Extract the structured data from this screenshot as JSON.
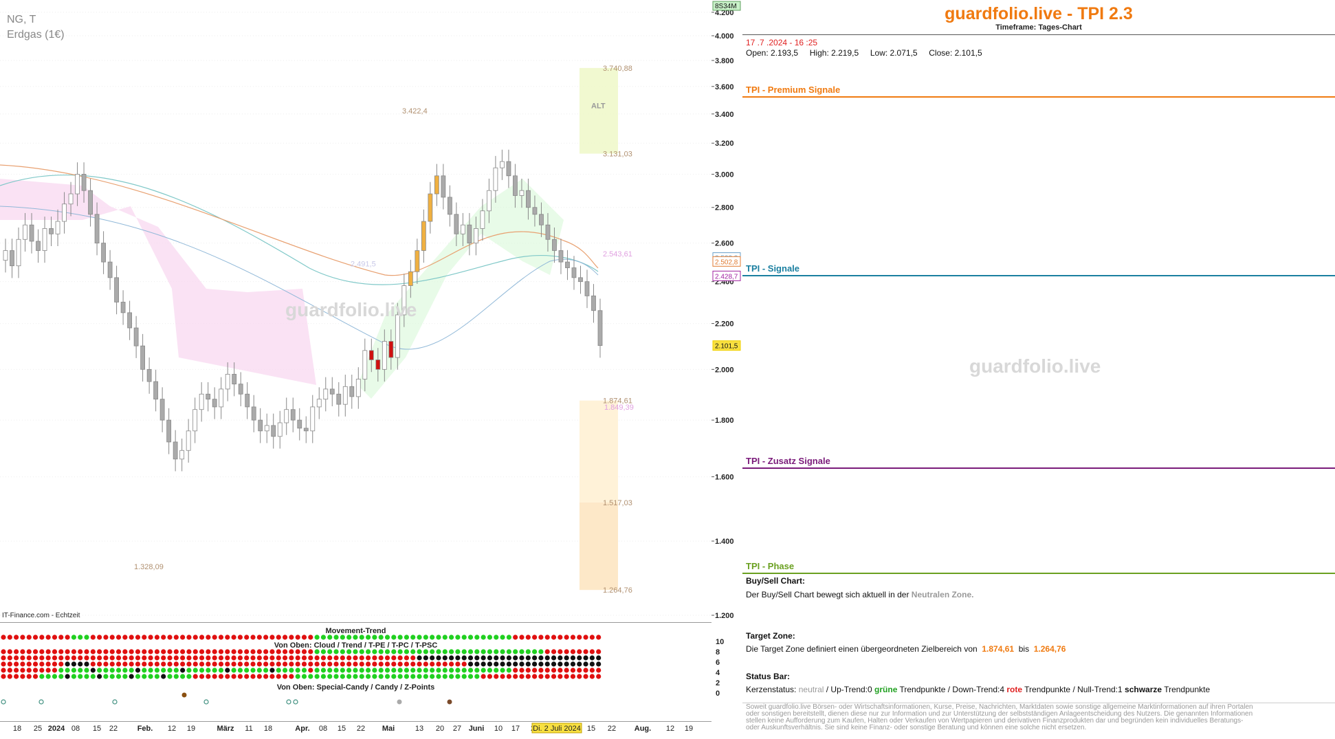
{
  "chart": {
    "symbol": "NG, T",
    "name": "Erdgas (1€)",
    "source": "IT-Finance.com - Echtzeit",
    "watermark": "guardfolio.live",
    "top_badge": "8S34M",
    "bottom_date_badge": "Di. 2 Juli 2024",
    "price_labels": [
      {
        "text": "3.740,88",
        "value": 3740.88
      },
      {
        "text": "3.131,03",
        "value": 3131.03
      },
      {
        "text": "3.422,4",
        "value": 3422.4
      },
      {
        "text": "2.543,61",
        "value": 2543.61
      },
      {
        "text": "2.491,5",
        "value": 2491.5
      },
      {
        "text": "1.874,61",
        "value": 1874.61
      },
      {
        "text": "1.849,39",
        "value": 1849.39
      },
      {
        "text": "1.517,03",
        "value": 1517.03
      },
      {
        "text": "1.328,09",
        "value": 1328.09
      },
      {
        "text": "1.264,76",
        "value": 1264.76
      }
    ],
    "zone_label": "ALT",
    "indicator_titles": {
      "movement": "Movement-Trend",
      "cloud": "Von Oben: Cloud / Trend / T-PE / T-PC / T-PSC",
      "special": "Von Oben: Special-Candy / Candy / Z-Points"
    }
  },
  "chart_data": {
    "type": "candlestick",
    "title": "NG, T",
    "subtitle": "Erdgas (1€)",
    "y_ticks": [
      "4.200",
      "4.000",
      "3.800",
      "3.600",
      "3.400",
      "3.200",
      "3.000",
      "2.800",
      "2.600",
      "2.400",
      "2.200",
      "2.000",
      "1.800",
      "1.600",
      "1.400",
      "1.200"
    ],
    "y_tick_values": [
      4200,
      4000,
      3800,
      3600,
      3400,
      3200,
      3000,
      2800,
      2600,
      2400,
      2200,
      2000,
      1800,
      1600,
      1400,
      1200
    ],
    "y_scale": "log",
    "ylim": [
      1160,
      4250
    ],
    "x_ticks": [
      "18",
      "25",
      "2024",
      "08",
      "15",
      "22",
      "Feb.",
      "12",
      "19",
      "März",
      "11",
      "18",
      "Apr.",
      "08",
      "15",
      "22",
      "Mai",
      "13",
      "20",
      "27",
      "Juni",
      "10",
      "17",
      "2",
      "Di. 2 Juli 2024",
      "15",
      "22",
      "Aug.",
      "12",
      "19"
    ],
    "axis_price_tags": [
      {
        "text": "2.523,3",
        "value": 2523.3,
        "color": "#6aa0c8"
      },
      {
        "text": "2.502,8",
        "value": 2502.8,
        "color": "#e07a30"
      },
      {
        "text": "2.428,7",
        "value": 2428.7,
        "color": "#a020a0"
      },
      {
        "text": "2.101,5",
        "value": 2101.5,
        "color": "#f0d000"
      }
    ],
    "last_close": 2101.5,
    "closes": [
      2560,
      2480,
      2620,
      2700,
      2610,
      2560,
      2680,
      2650,
      2720,
      2820,
      2880,
      3000,
      2900,
      2760,
      2600,
      2500,
      2420,
      2300,
      2250,
      2180,
      2100,
      2000,
      1950,
      1880,
      1800,
      1720,
      1660,
      1690,
      1760,
      1840,
      1900,
      1880,
      1850,
      1920,
      1980,
      1940,
      1900,
      1850,
      1800,
      1760,
      1780,
      1740,
      1790,
      1840,
      1800,
      1770,
      1760,
      1850,
      1880,
      1920,
      1900,
      1860,
      1930,
      1890,
      1960,
      2080,
      2040,
      2000,
      2120,
      2050,
      2240,
      2380,
      2450,
      2560,
      2720,
      2880,
      2990,
      2860,
      2760,
      2650,
      2700,
      2600,
      2680,
      2780,
      2900,
      3040,
      3080,
      2990,
      2870,
      2900,
      2800,
      2760,
      2700,
      2620,
      2560,
      2500,
      2470,
      2420,
      2400,
      2330,
      2260,
      2101.5
    ],
    "candle_window": "2023-12-18 to 2024-07-17",
    "quote": {
      "datetime": "17 .7 .2024 - 16 :25",
      "open": "2.193,5",
      "high": "2.219,5",
      "low": "2.071,5",
      "close": "2.101,5"
    }
  },
  "sidebar": {
    "title": "guardfolio.live - TPI 2.3",
    "timeframe": "Timeframe: Tages-Chart",
    "datetime": "17 .7 .2024 - 16 :25",
    "ohlc": {
      "open_label": "Open:",
      "open": "2.193,5",
      "high_label": "High:",
      "high": "2.219,5",
      "low_label": "Low:",
      "low": "2.071,5",
      "close_label": "Close:",
      "close": "2.101,5"
    },
    "sections": {
      "premium": "TPI - Premium Signale",
      "signale": "TPI - Signale",
      "zusatz": "TPI - Zusatz Signale",
      "phase": "TPI - Phase"
    },
    "watermark": "guardfolio.live",
    "buysell_title": "Buy/Sell Chart:",
    "buysell_text": "Der Buy/Sell Chart bewegt sich aktuell in der",
    "buysell_zone": "Neutralen Zone.",
    "target_title": "Target Zone:",
    "target_text": "Die Target Zone definiert einen übergeordneten Zielbereich von",
    "target_from": "1.874,61",
    "target_bis": "bis",
    "target_to": "1.264,76",
    "status_title": "Status Bar:",
    "status_prefix": "Kerzenstatus:",
    "status_neutral": "neutral",
    "status_up": "/ Up-Trend:0",
    "status_gruene": "grüne",
    "status_tp1": "Trendpunkte  / Down-Trend:4",
    "status_rote": "rote",
    "status_tp2": "Trendpunkte  / Null-Trend:1",
    "status_schwarze": "schwarze",
    "status_tp3": "Trendpunkte",
    "disclaimer": "Soweit guardfolio.live Börsen- oder Wirtschaftsinformationen, Kurse, Preise, Nachrichten, Marktdaten sowie sonstige allgemeine Marktinformationen auf ihren Portalen oder sonstigen bereitstellt, dienen diese nur zur Information und zur Unterstützung der selbstständigen Anlageentscheidung des Nutzers. Die genannten Informationen stellen keine Aufforderung zum Kaufen, Halten oder Verkaufen von Wertpapieren und derivativen Finanzprodukten dar und begründen kein individuelles Beratungs- oder Auskunftsverhältnis. Sie sind keine Finanz- oder sonstige Beratung und können eine solche nicht ersetzen."
  },
  "indicator_axis": [
    "10",
    "8",
    "6",
    "4",
    "2",
    "0"
  ],
  "colors": {
    "accent": "#f07a10",
    "premium": "#f07a10",
    "signale": "#1a7fa0",
    "zusatz": "#7a1a7a",
    "phase": "#6aa020",
    "red": "#e01010",
    "green": "#20d020",
    "black": "#111111"
  }
}
